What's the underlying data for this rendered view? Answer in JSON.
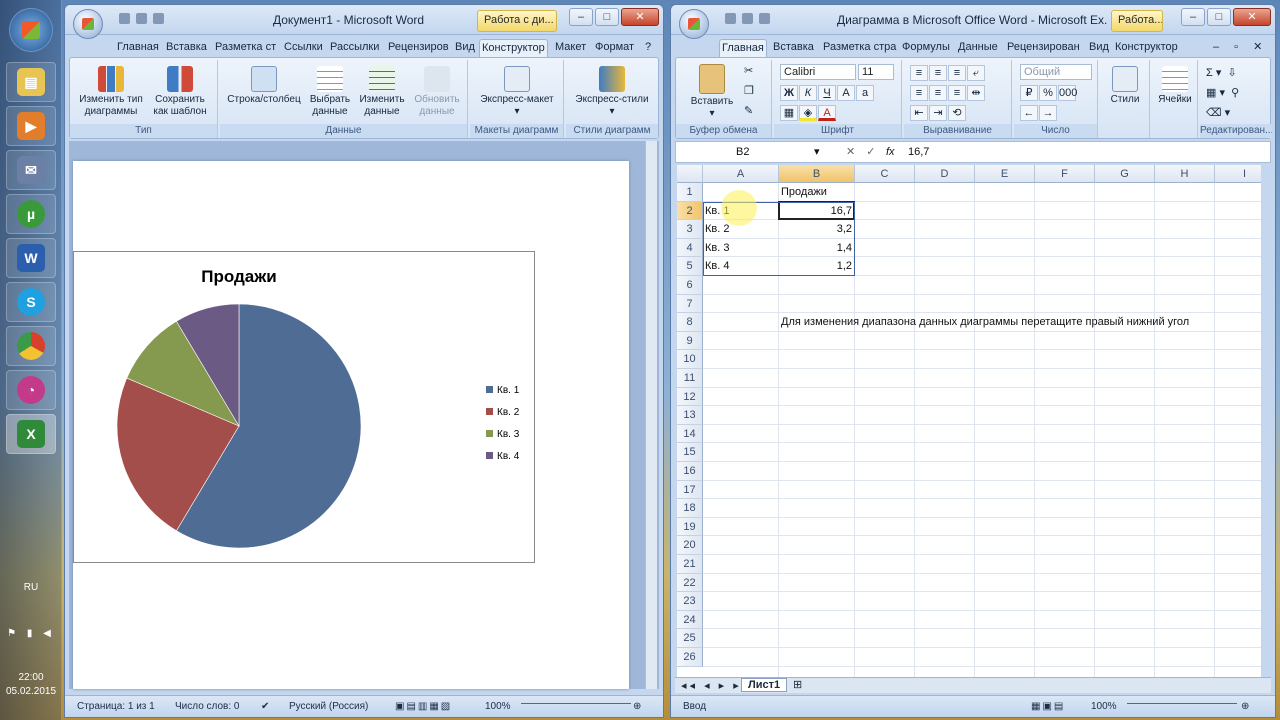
{
  "taskbar": {
    "lang": "RU",
    "time": "22:00",
    "date": "05.02.2015"
  },
  "word": {
    "title": "Документ1 - Microsoft Word",
    "context_tab": "Работа с ди...",
    "tabs": [
      "Главная",
      "Вставка",
      "Разметка ст",
      "Ссылки",
      "Рассылки",
      "Рецензиров",
      "Вид",
      "Конструктор",
      "Макет",
      "Формат"
    ],
    "active_tab": "Конструктор",
    "groups": {
      "type": {
        "label": "Тип",
        "btn_change_type": "Изменить тип диаграммы",
        "btn_save_template": "Сохранить как шаблон"
      },
      "data": {
        "label": "Данные",
        "btn_row_col": "Строка/столбец",
        "btn_select": "Выбрать данные",
        "btn_edit": "Изменить данные",
        "btn_refresh": "Обновить данные"
      },
      "layouts": {
        "label": "Макеты диаграмм",
        "btn": "Экспресс-макет"
      },
      "styles": {
        "label": "Стили диаграмм",
        "btn": "Экспресс-стили"
      }
    },
    "status": {
      "page": "Страница: 1 из 1",
      "words": "Число слов: 0",
      "lang": "Русский (Россия)",
      "zoom": "100%"
    }
  },
  "excel": {
    "title": "Диаграмма в Microsoft Office Word - Microsoft Ex...",
    "context_tab": "Работа...",
    "tabs": [
      "Главная",
      "Вставка",
      "Разметка стра",
      "Формулы",
      "Данные",
      "Рецензирован",
      "Вид",
      "Конструктор"
    ],
    "active_tab": "Главная",
    "ribbon": {
      "clipboard": {
        "label": "Буфер обмена",
        "paste": "Вставить"
      },
      "font": {
        "label": "Шрифт",
        "name": "Calibri",
        "size": "11",
        "bold": "Ж",
        "italic": "К",
        "underline": "Ч"
      },
      "align": {
        "label": "Выравнивание"
      },
      "number": {
        "label": "Число",
        "format": "Общий"
      },
      "styles": {
        "label": "Стили"
      },
      "cells": {
        "label": "Ячейки"
      },
      "editing": {
        "label": "Редактирован..."
      }
    },
    "name_box": "B2",
    "formula_value": "16,7",
    "fx": "fx",
    "columns": [
      "A",
      "B",
      "C",
      "D",
      "E",
      "F",
      "G",
      "H",
      "I"
    ],
    "rows": [
      "1",
      "2",
      "3",
      "4",
      "5",
      "6",
      "7",
      "8",
      "9",
      "10",
      "11",
      "12",
      "13",
      "14",
      "15",
      "16",
      "17",
      "18",
      "19",
      "20",
      "21",
      "22",
      "23",
      "24",
      "25",
      "26"
    ],
    "cells": {
      "B1": "Продажи",
      "A2": "Кв. 1",
      "B2": "16,7",
      "A3": "Кв. 2",
      "B3": "3,2",
      "A4": "Кв. 3",
      "B4": "1,4",
      "A5": "Кв. 4",
      "B5": "1,2",
      "B8": "Для изменения диапазона данных диаграммы перетащите правый нижний угол"
    },
    "sheet_tab": "Лист1",
    "status": {
      "mode": "Ввод",
      "zoom": "100%"
    }
  },
  "chart_data": {
    "type": "pie",
    "title": "Продажи",
    "categories": [
      "Кв. 1",
      "Кв. 2",
      "Кв. 3",
      "Кв. 4"
    ],
    "values": [
      8.2,
      3.2,
      1.4,
      1.2
    ],
    "colors": [
      "#4f6d94",
      "#a44e4b",
      "#869a4f",
      "#6b5a84"
    ],
    "legend": "right"
  }
}
